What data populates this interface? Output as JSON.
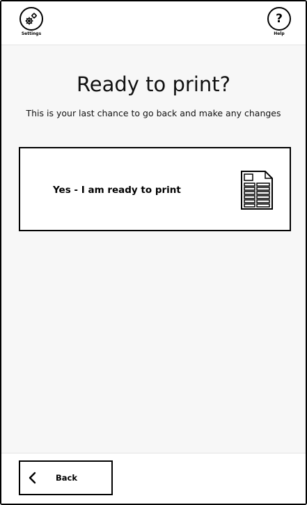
{
  "header": {
    "settings_label": "Settings",
    "help_label": "Help",
    "help_glyph": "?",
    "settings_icon": "gears-icon"
  },
  "main": {
    "title": "Ready to print?",
    "subtitle": "This is your last chance to go back and make any changes",
    "option": {
      "label": "Yes - I am ready to print",
      "icon": "document-icon"
    }
  },
  "footer": {
    "back_label": "Back",
    "back_icon": "chevron-left-icon"
  }
}
